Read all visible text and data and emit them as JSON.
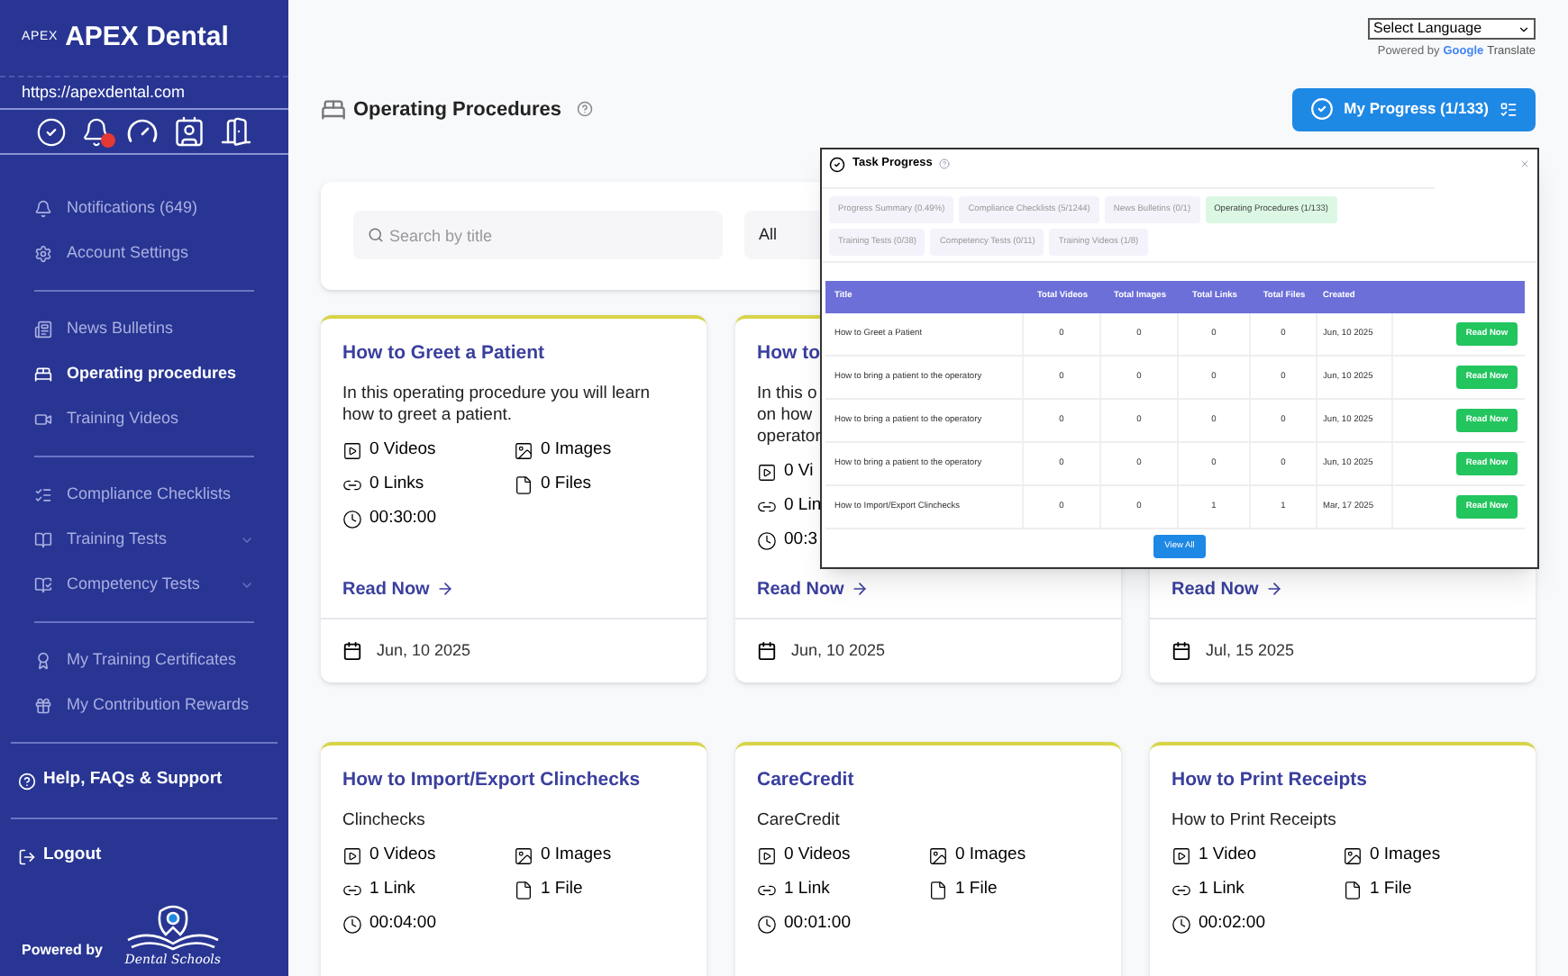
{
  "sidebar": {
    "brand_mark": "APEX",
    "brand": "APEX Dental",
    "url": "https://apexdental.com",
    "groups": [
      [
        {
          "label": "Notifications (649)",
          "selected": false,
          "has_submenu": false
        },
        {
          "label": "Account Settings",
          "selected": false,
          "has_submenu": false
        }
      ],
      [
        {
          "label": "News Bulletins",
          "selected": false,
          "has_submenu": false
        },
        {
          "label": "Operating procedures",
          "selected": true,
          "has_submenu": false
        },
        {
          "label": "Training Videos",
          "selected": false,
          "has_submenu": false
        }
      ],
      [
        {
          "label": "Compliance Checklists",
          "selected": false,
          "has_submenu": false
        },
        {
          "label": "Training Tests",
          "selected": false,
          "has_submenu": true
        },
        {
          "label": "Competency Tests",
          "selected": false,
          "has_submenu": true
        }
      ],
      [
        {
          "label": "My Training Certificates",
          "selected": false,
          "has_submenu": false
        },
        {
          "label": "My Contribution Rewards",
          "selected": false,
          "has_submenu": false
        }
      ]
    ],
    "help": "Help, FAQs & Support",
    "logout": "Logout",
    "powered_by": "Powered by",
    "partner_logo_text": "Dental Schools"
  },
  "translate": {
    "select": "Select Language",
    "powered_by": "Powered by",
    "google": "Google",
    "translate": "Translate"
  },
  "page": {
    "title": "Operating Procedures",
    "progress_button": "My Progress (1/133)"
  },
  "filter": {
    "search_placeholder": "Search by title",
    "category": "All"
  },
  "cards": [
    {
      "title": "How to Greet a Patient",
      "description": "In this operating procedure you will learn how to greet a patient.",
      "videos": "0 Videos",
      "images": "0 Images",
      "links": "0 Links",
      "files": "0 Files",
      "duration": "00:30:00",
      "read_now": "Read Now",
      "date": "Jun, 10 2025"
    },
    {
      "title": "How to",
      "description": "In this o\non how\noperator",
      "videos": "0 Vi",
      "links": "0 Lin",
      "duration": "00:3",
      "read_now": "Read Now",
      "date": "Jun, 10 2025"
    },
    {
      "read_now": "Read Now",
      "date": "Jul, 15 2025"
    },
    {
      "title": "How to Import/Export Clinchecks",
      "description": "Clinchecks",
      "videos": "0 Videos",
      "images": "0 Images",
      "links": "1 Link",
      "files": "1 File",
      "duration": "00:04:00"
    },
    {
      "title": "CareCredit",
      "description": "CareCredit",
      "videos": "0 Videos",
      "images": "0 Images",
      "links": "1 Link",
      "files": "1 File",
      "duration": "00:01:00"
    },
    {
      "title": "How to Print Receipts",
      "description": "How to Print Receipts",
      "videos": "1 Video",
      "images": "0 Images",
      "links": "1 Link",
      "files": "1 File",
      "duration": "00:02:00"
    }
  ],
  "task_progress": {
    "title": "Task Progress",
    "tabs": [
      {
        "label": "Progress Summary (0.49%)",
        "selected": false
      },
      {
        "label": "Compliance Checklists (5/1244)",
        "selected": false
      },
      {
        "label": "News Bulletins (0/1)",
        "selected": false
      },
      {
        "label": "Operating Procedures (1/133)",
        "selected": true
      },
      {
        "label": "Training Tests (0/38)",
        "selected": false
      },
      {
        "label": "Competency Tests (0/11)",
        "selected": false
      },
      {
        "label": "Training Videos (1/8)",
        "selected": false
      }
    ],
    "columns": [
      "Title",
      "Total Videos",
      "Total Images",
      "Total Links",
      "Total Files",
      "Created"
    ],
    "rows": [
      {
        "cells": [
          "How to Greet a Patient",
          "0",
          "0",
          "0",
          "0",
          "Jun, 10 2025"
        ],
        "action": "Read Now"
      },
      {
        "cells": [
          "How to bring a patient to the operatory",
          "0",
          "0",
          "0",
          "0",
          "Jun, 10 2025"
        ],
        "action": "Read Now"
      },
      {
        "cells": [
          "How to bring a patient to the operatory",
          "0",
          "0",
          "0",
          "0",
          "Jun, 10 2025"
        ],
        "action": "Read Now"
      },
      {
        "cells": [
          "How to bring a patient to the operatory",
          "0",
          "0",
          "0",
          "0",
          "Jun, 10 2025"
        ],
        "action": "Read Now"
      },
      {
        "cells": [
          "How to Import/Export Clinchecks",
          "0",
          "0",
          "1",
          "1",
          "Mar, 17 2025"
        ],
        "action": "Read Now"
      }
    ],
    "view_all": "View All"
  }
}
